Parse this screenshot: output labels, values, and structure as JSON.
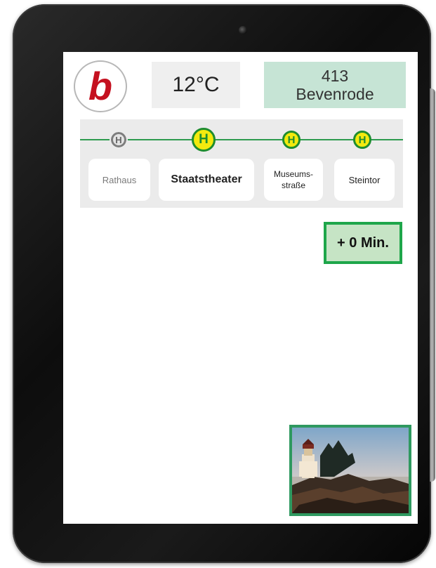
{
  "header": {
    "logo_letter": "b",
    "temperature": "12°C",
    "route_number": "413",
    "route_destination": "Bevenrode"
  },
  "stops": [
    {
      "name": "Rathaus",
      "status": "passed",
      "icon": "bus-stop-icon"
    },
    {
      "name": "Staatstheater",
      "status": "current",
      "icon": "bus-stop-icon"
    },
    {
      "name": "Museums-",
      "name_line2": "straße",
      "status": "upcoming",
      "icon": "bus-stop-icon"
    },
    {
      "name": "Steintor",
      "status": "upcoming",
      "icon": "bus-stop-icon"
    }
  ],
  "stop_symbol": "H",
  "delay": "+ 0 Min.",
  "colors": {
    "brand_red": "#c51120",
    "line_green": "#2e9b4f",
    "stop_yellow": "#f3ea0e",
    "route_bg": "#c6e4d5",
    "delay_bg": "#c6e4c5"
  },
  "image": {
    "icon": "lighthouse-photo"
  }
}
